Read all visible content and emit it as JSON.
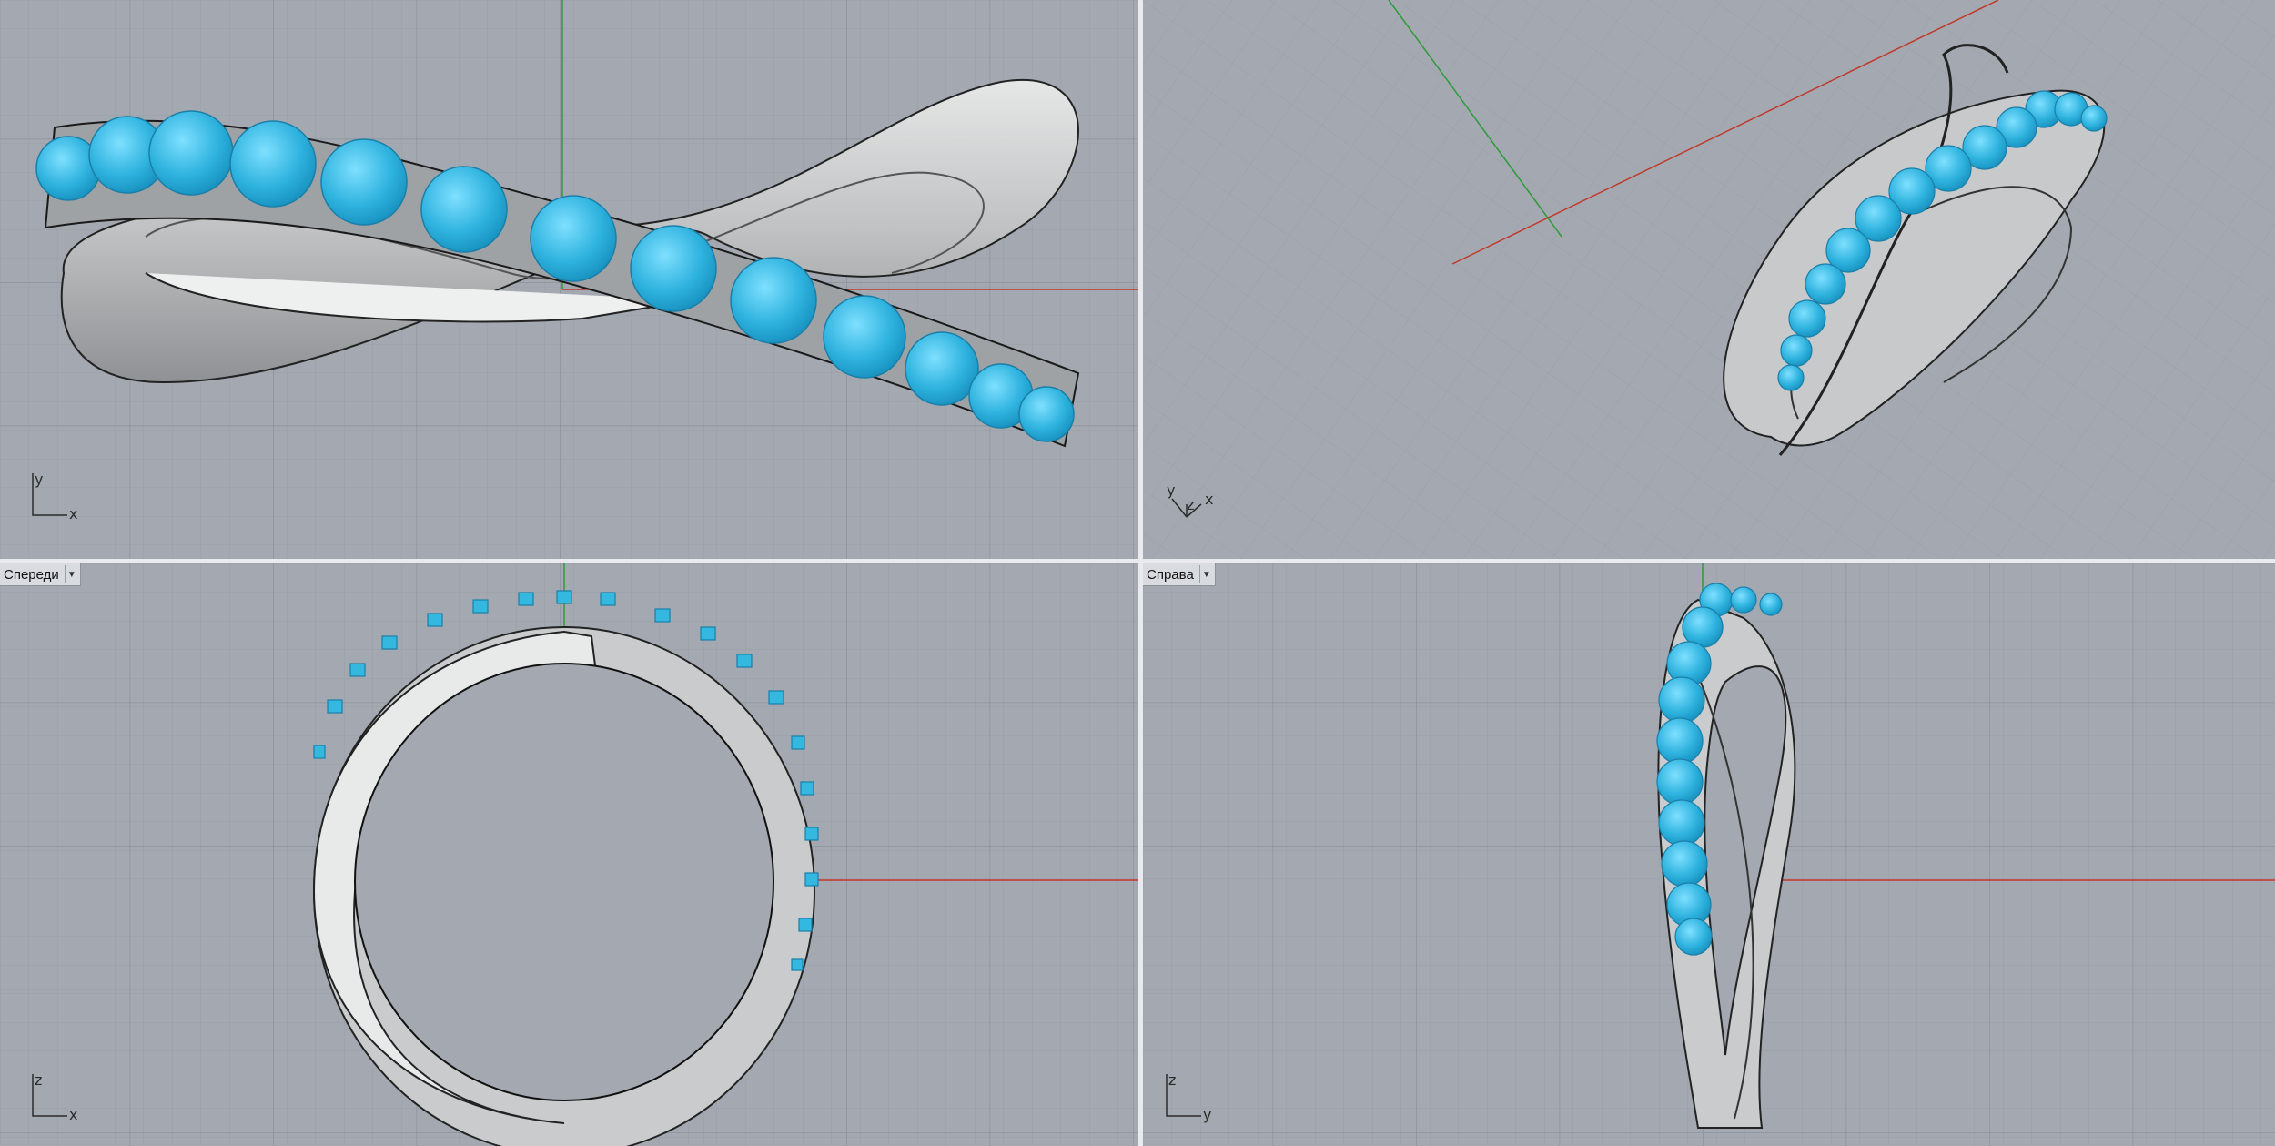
{
  "app": "Rhinoceros 3D",
  "viewports": {
    "top": {
      "label": "",
      "axes": [
        "y",
        "x"
      ]
    },
    "perspective": {
      "label": "",
      "axes": [
        "y",
        "z",
        "x"
      ]
    },
    "front": {
      "label": "Спереди",
      "axes": [
        "z",
        "x"
      ]
    },
    "right": {
      "label": "Справа",
      "axes": [
        "z",
        "y"
      ]
    }
  },
  "colors": {
    "background": "#a4a9b1",
    "grid_minor": "#99a0a8",
    "grid_major": "#8d949d",
    "axis_x": "#c0392b",
    "axis_y": "#2e9b3a",
    "metal": "#c9cbcc",
    "gem": "#35b8e0"
  },
  "icons": {
    "dropdown": "chevron-down-icon"
  }
}
